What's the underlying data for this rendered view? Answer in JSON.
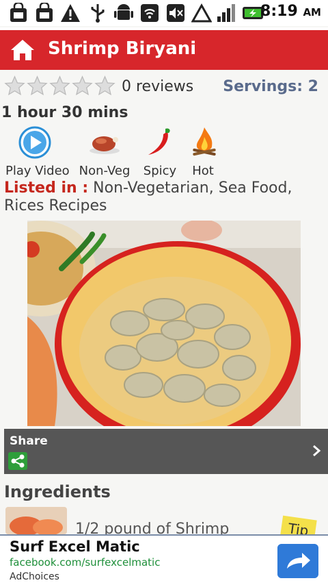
{
  "status_bar": {
    "time": "8:19",
    "ampm": "AM",
    "icons": [
      "bag-icon",
      "bag-icon",
      "warning-icon",
      "usb-icon",
      "android-icon",
      "wifi-icon",
      "mute-icon",
      "signal-triangle-icon",
      "signal-bars-icon",
      "battery-charging-icon"
    ]
  },
  "header": {
    "title": "Shrimp Biryani",
    "home_icon": "home-icon",
    "color": "#d7262b"
  },
  "rating": {
    "stars_filled": 0,
    "stars_total": 5,
    "reviews": "0 reviews",
    "servings": "Servings: 2"
  },
  "time": "1 hour 30 mins",
  "features": [
    {
      "label": "Play Video",
      "icon": "play-video-icon"
    },
    {
      "label": "Non-Veg",
      "icon": "roast-chicken-icon"
    },
    {
      "label": "Spicy",
      "icon": "chili-icon"
    },
    {
      "label": "Hot",
      "icon": "fire-icon"
    }
  ],
  "listed": {
    "label": "Listed in :",
    "value": " Non-Vegetarian, Sea Food, Rices Recipes"
  },
  "share": {
    "label": "Share",
    "icon": "share-icon"
  },
  "ingredients": {
    "title": "Ingredients",
    "first_item": "1/2 pound of Shrimp",
    "tip": "Tip"
  },
  "ad": {
    "title": "Surf Excel Matic",
    "url": "facebook.com/surfexcelmatic",
    "choices": "AdChoices"
  }
}
